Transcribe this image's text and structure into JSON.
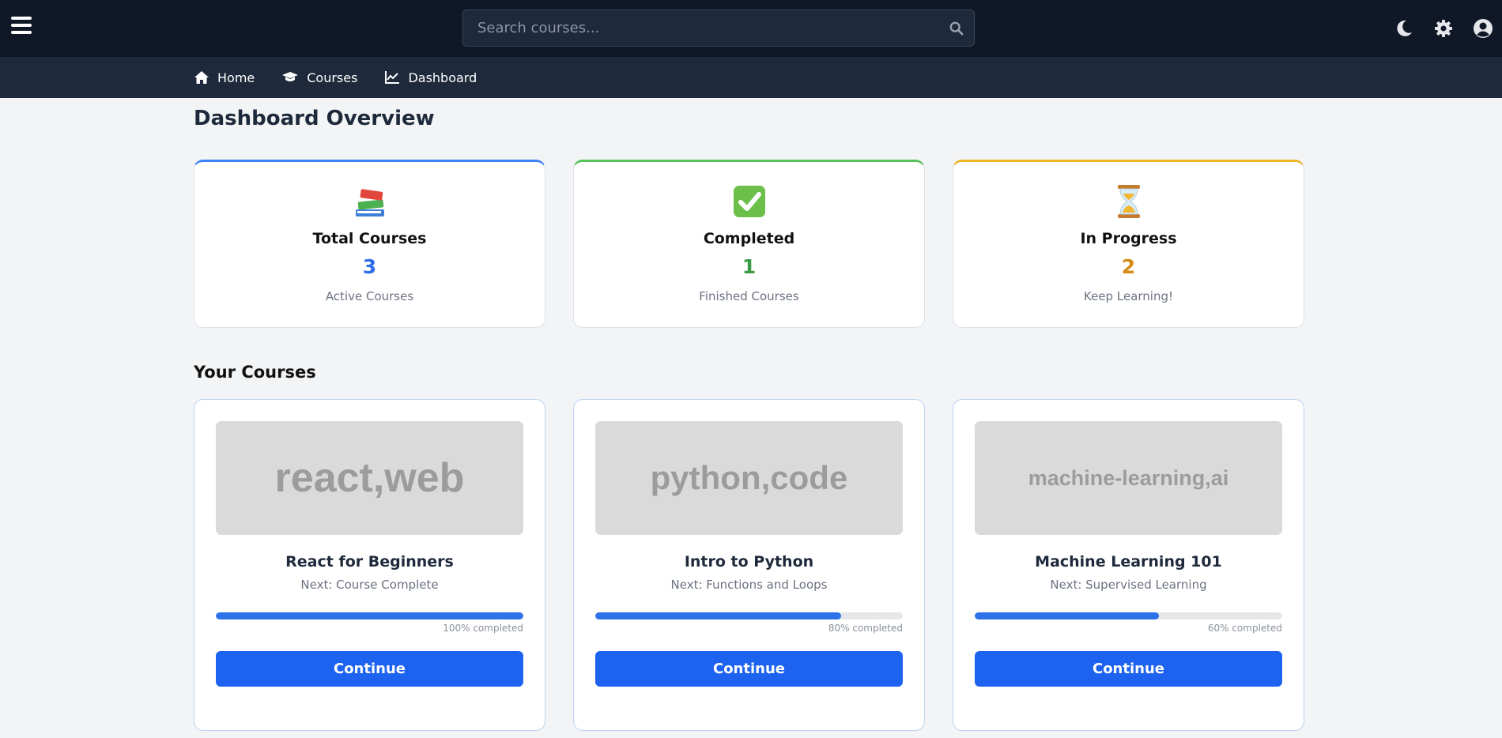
{
  "search": {
    "placeholder": "Search courses..."
  },
  "nav": [
    {
      "label": "Home"
    },
    {
      "label": "Courses"
    },
    {
      "label": "Dashboard"
    }
  ],
  "page_title": "Dashboard Overview",
  "stats": [
    {
      "emoji": "📚",
      "label": "Total Courses",
      "value": "3",
      "sub": "Active Courses",
      "color": "#2f6be8"
    },
    {
      "emoji": "✅",
      "label": "Completed",
      "value": "1",
      "sub": "Finished Courses",
      "color": "#3c9a48"
    },
    {
      "emoji": "⏳",
      "label": "In Progress",
      "value": "2",
      "sub": "Keep Learning!",
      "color": "#d48a14"
    }
  ],
  "section_title": "Your Courses",
  "courses": [
    {
      "thumb": "react,web",
      "title": "React for Beginners",
      "next": "Next: Course Complete",
      "progress": 100,
      "progress_label": "100% completed",
      "button": "Continue"
    },
    {
      "thumb": "python,code",
      "title": "Intro to Python",
      "next": "Next: Functions and Loops",
      "progress": 80,
      "progress_label": "80% completed",
      "button": "Continue"
    },
    {
      "thumb": "machine-learning,ai",
      "title": "Machine Learning 101",
      "next": "Next: Supervised Learning",
      "progress": 60,
      "progress_label": "60% completed",
      "button": "Continue"
    }
  ],
  "icons": {
    "menu": "hamburger-menu-icon",
    "search": "search-icon",
    "theme": "moon-icon",
    "settings": "gear-icon",
    "profile": "user-circle-icon"
  }
}
